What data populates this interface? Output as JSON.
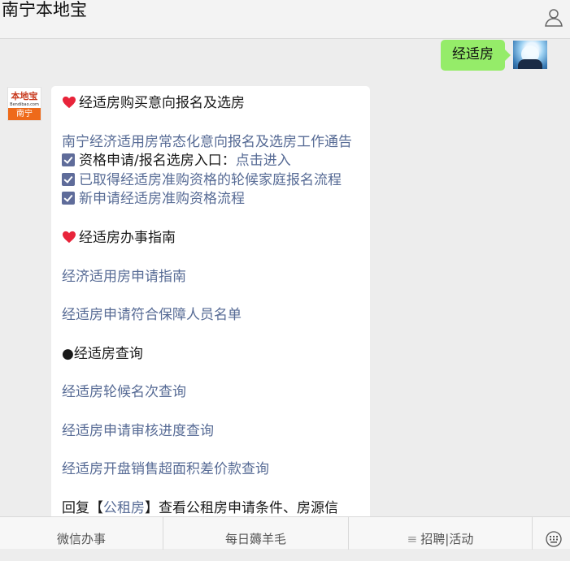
{
  "header": {
    "title": "南宁本地宝",
    "user_icon": "user-icon"
  },
  "outgoing_message": {
    "text": "经适房"
  },
  "bot": {
    "avatar_logo_text": "本地宝",
    "avatar_logo_url": "Bendibao.com",
    "avatar_city": "南宁"
  },
  "reply": {
    "section1_title": "经适房购买意向报名及选房",
    "notice_link": "南宁经济适用房常态化意向报名及选房工作通告",
    "item1_prefix": "资格申请/报名选房入口：",
    "item1_link": "点击进入",
    "item2": "已取得经适房准购资格的轮候家庭报名流程",
    "item3": "新申请经适房准购资格流程",
    "section2_title": "经适房办事指南",
    "guide_link1": "经济适用房申请指南",
    "guide_link2": "经适房申请符合保障人员名单",
    "section3_title": "●经适房查询",
    "query_link1": "经适房轮候名次查询",
    "query_link2": "经适房申请审核进度查询",
    "query_link3": "经适房开盘销售超面积差价款查询",
    "footer_prefix": "回复【",
    "footer_keyword": "公租房",
    "footer_suffix": "】查看公租房申请条件、房源信"
  },
  "bottom_menu": {
    "item1": "微信办事",
    "item2": "每日薅羊毛",
    "item3_icon": "≡",
    "item3": "招聘|活动",
    "keyboard_icon": "keyboard-icon"
  },
  "colors": {
    "link": "#576b95",
    "outgoing_bubble": "#95ec69",
    "heart": "#e8243a",
    "checkbox": "#5f6c9a"
  }
}
